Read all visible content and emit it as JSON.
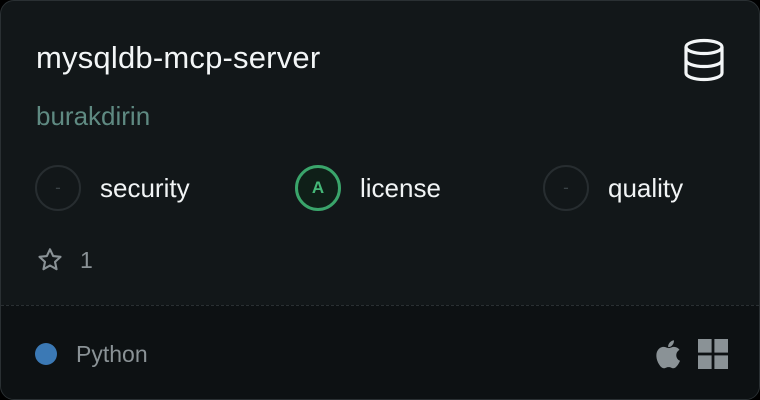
{
  "card": {
    "title": "mysqldb-mcp-server",
    "author": "burakdirin",
    "type_icon": "database-icon"
  },
  "badges": [
    {
      "grade": "-",
      "label": "security",
      "state": "none"
    },
    {
      "grade": "A",
      "label": "license",
      "state": "graded"
    },
    {
      "grade": "-",
      "label": "quality",
      "state": "none"
    }
  ],
  "stars": {
    "icon": "star-outline-icon",
    "count": "1"
  },
  "footer": {
    "language": "Python",
    "language_color": "#3b79b5",
    "platforms": [
      "apple-icon",
      "windows-icon"
    ]
  },
  "colors": {
    "card_bg": "#121719",
    "author": "#5f8a82",
    "grade_green": "#3aa56b",
    "muted": "#8a9296"
  }
}
